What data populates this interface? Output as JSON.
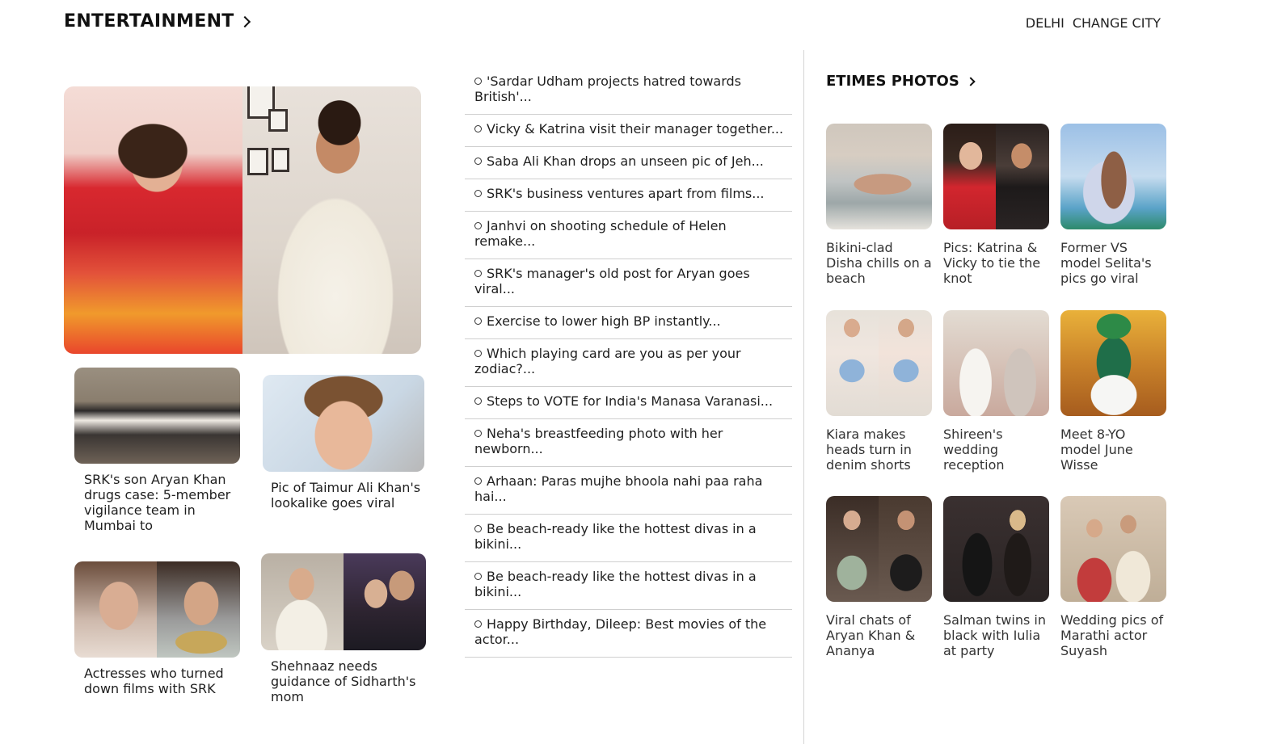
{
  "header": {
    "section_title": "ENTERTAINMENT",
    "city": "DELHI",
    "change_city": "CHANGE CITY"
  },
  "news_cards": [
    {
      "caption": "SRK's son Aryan Khan drugs case: 5-member vigilance team in Mumbai to"
    },
    {
      "caption": "Pic of Taimur Ali Khan's lookalike goes viral"
    },
    {
      "caption": "Actresses who turned down films with SRK"
    },
    {
      "caption": "Shehnaaz needs guidance of Sidharth's mom"
    }
  ],
  "headlines": [
    "'Sardar Udham projects hatred towards British'...",
    "Vicky & Katrina visit their manager together...",
    "Saba Ali Khan drops an unseen pic of Jeh...",
    "SRK's business ventures apart from films...",
    "Janhvi on shooting schedule of Helen remake...",
    "SRK's manager's old post for Aryan goes viral...",
    "Exercise to lower high BP instantly...",
    "Which playing card are you as per your zodiac?...",
    "Steps to VOTE for India's Manasa Varanasi...",
    "Neha's breastfeeding photo with her newborn...",
    "Arhaan: Paras mujhe bhoola nahi paa raha hai...",
    "Be beach-ready like the hottest divas in a bikini...",
    "Be beach-ready like the hottest divas in a bikini...",
    "Happy Birthday, Dileep: Best movies of the actor..."
  ],
  "etimes": {
    "title": "ETIMES PHOTOS",
    "photos": [
      {
        "caption": "Bikini-clad Disha chills on a beach"
      },
      {
        "caption": "Pics: Katrina & Vicky to tie the knot"
      },
      {
        "caption": "Former VS model Selita's pics go viral"
      },
      {
        "caption": "Kiara makes heads turn in denim shorts"
      },
      {
        "caption": "Shireen's wedding reception"
      },
      {
        "caption": "Meet 8-YO model June Wisse"
      },
      {
        "caption": "Viral chats of Aryan Khan & Ananya"
      },
      {
        "caption": "Salman twins in black with Iulia at party"
      },
      {
        "caption": "Wedding pics of Marathi actor Suyash"
      }
    ]
  }
}
